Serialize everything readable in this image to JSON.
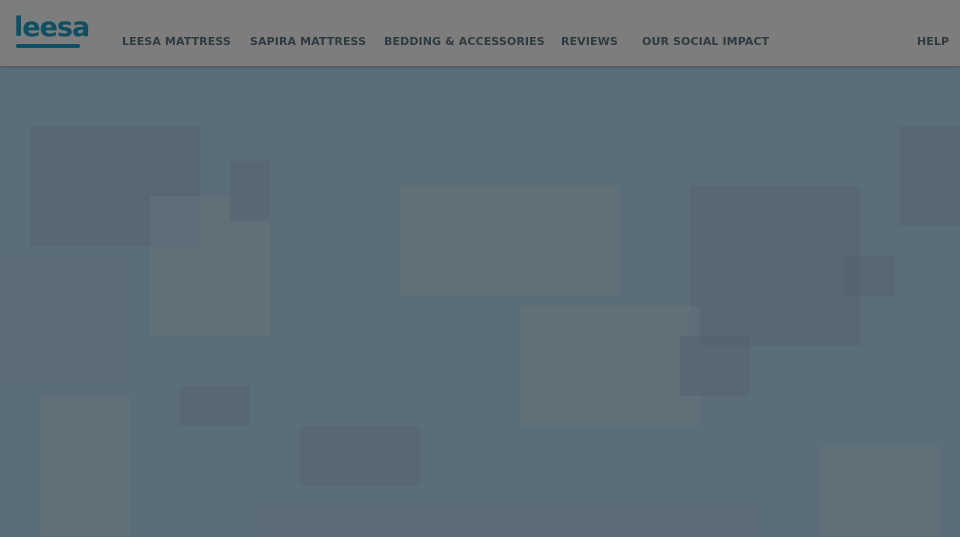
{
  "brand": {
    "logo_text": "leesa",
    "accent_color": "#0f4f63"
  },
  "nav": {
    "items": [
      {
        "label": "LEESA MATTRESS"
      },
      {
        "label": "SAPIRA MATTRESS"
      },
      {
        "label": "BEDDING & ACCESSORIES"
      },
      {
        "label": "REVIEWS"
      },
      {
        "label": "OUR SOCIAL IMPACT"
      }
    ],
    "help_label": "HELP"
  },
  "hero": {
    "background_color": "#5f6f79"
  }
}
